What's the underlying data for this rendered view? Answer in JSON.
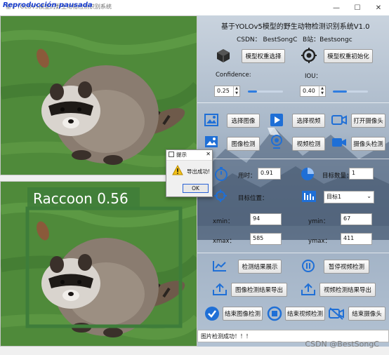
{
  "window": {
    "title": "基于YOLOv5模型的野生动物检测识别系统",
    "recording_overlay": "Reproducción pausada",
    "minimize": "—",
    "maximize": "☐",
    "close": "✕"
  },
  "images": {
    "top_alt": "raccoon original image",
    "bottom_detection_label": "Raccoon 0.56",
    "box_color": "#3e7d3a"
  },
  "header": {
    "app_title": "基于YOLOv5模型的野生动物检测识别系统V1.0",
    "csdn": "CSDN： BestSongC",
    "bilibili": "B站：Bestsongc"
  },
  "model": {
    "select_label": "模型权重选择",
    "init_label": "模型权重初始化"
  },
  "params": {
    "confidence_label": "Confidence:",
    "confidence_value": "0.25",
    "confidence_level": 0.25,
    "iou_label": "IOU：",
    "iou_value": "0.40",
    "iou_level": 0.4
  },
  "sources": {
    "select_image": "选择图像",
    "select_video": "选择视频",
    "open_camera": "打开摄像头",
    "image_detect": "图像检测",
    "video_detect": "视频检测",
    "camera_detect": "摄像头检测"
  },
  "results": {
    "time_label": "用时：",
    "time_value": "0.91",
    "count_label": "目标数量：",
    "count_value": "1",
    "position_label": "目标位置：",
    "target_select": "目标1",
    "xmin_label": "xmin：",
    "xmin_value": "94",
    "ymin_label": "ymin：",
    "ymin_value": "67",
    "xmax_label": "xmax：",
    "xmax_value": "585",
    "ymax_label": "ymax：",
    "ymax_value": "411"
  },
  "actions": {
    "show_results": "检测结果展示",
    "pause_video": "暂停视频检测",
    "export_image": "图像检测结果导出",
    "export_video": "视频检测结果导出",
    "end_image": "结束图像检测",
    "end_video": "结束视频检测",
    "end_camera": "结束摄像头"
  },
  "status": {
    "message": "图片检测成功！！！",
    "watermark": "CSDN @BestSongC"
  },
  "dialog": {
    "title": "提示",
    "message": "导出成功!",
    "ok": "OK",
    "close": "✕"
  },
  "colors": {
    "accent": "#2e7de0",
    "icon_blue": "#1f6fd6"
  }
}
